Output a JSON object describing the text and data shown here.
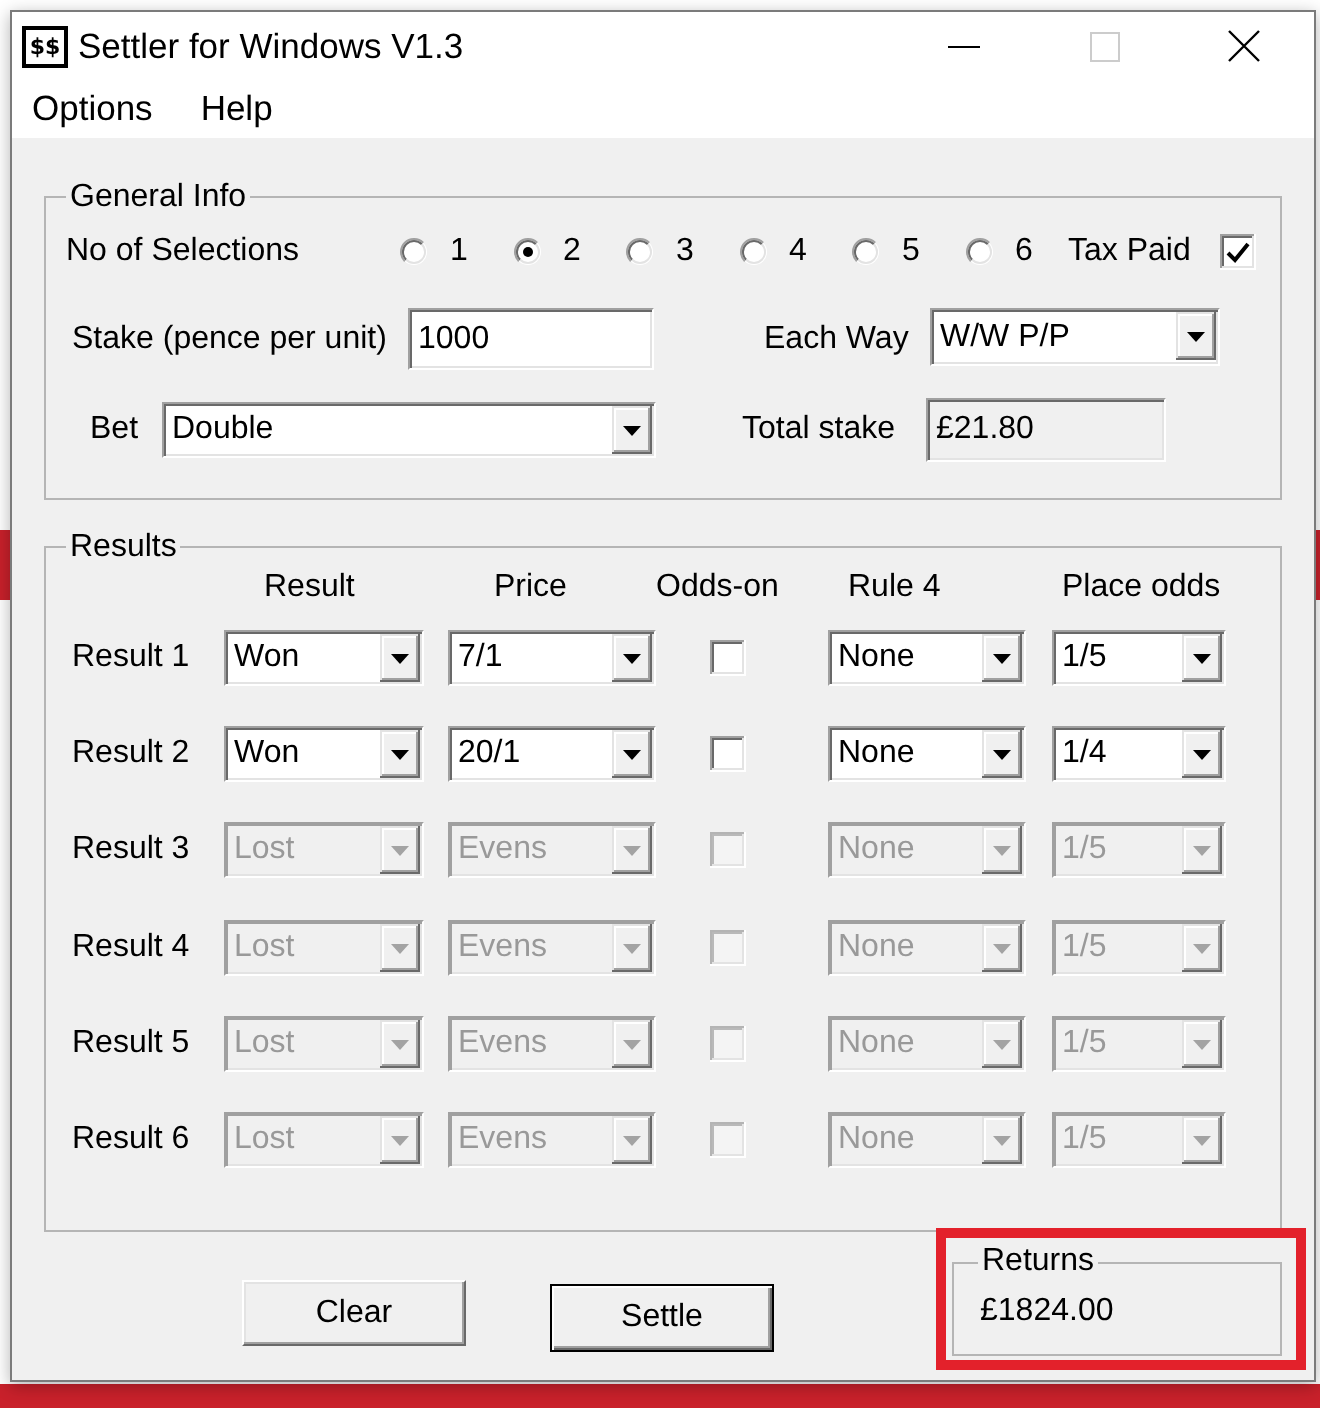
{
  "window": {
    "title": "Settler for Windows V1.3",
    "icon_text": "$$",
    "controls": [
      {
        "kind": "minimize",
        "disabled": false
      },
      {
        "kind": "maximize",
        "disabled": true
      },
      {
        "kind": "close",
        "disabled": false
      }
    ]
  },
  "menu": [
    "Options",
    "Help"
  ],
  "general_info": {
    "legend": "General Info",
    "selections_label": "No of Selections",
    "selections": [
      {
        "label": "1",
        "selected": false
      },
      {
        "label": "2",
        "selected": true
      },
      {
        "label": "3",
        "selected": false
      },
      {
        "label": "4",
        "selected": false
      },
      {
        "label": "5",
        "selected": false
      },
      {
        "label": "6",
        "selected": false
      }
    ],
    "tax_paid": {
      "label": "Tax Paid",
      "checked": true
    },
    "stake": {
      "label": "Stake (pence per unit)",
      "value": "1000"
    },
    "each_way": {
      "label": "Each Way",
      "value": "W/W P/P"
    },
    "bet": {
      "label": "Bet",
      "value": "Double"
    },
    "total_stake": {
      "label": "Total stake",
      "value": "£21.80",
      "read_only": true
    }
  },
  "results": {
    "legend": "Results",
    "columns": [
      "Result",
      "Price",
      "Odds-on",
      "Rule 4",
      "Place odds"
    ],
    "rows": [
      {
        "label": "Result 1",
        "disabled": false,
        "result": "Won",
        "price": "7/1",
        "odds_on": false,
        "rule_4": "None",
        "place_odds": "1/5"
      },
      {
        "label": "Result 2",
        "disabled": false,
        "result": "Won",
        "price": "20/1",
        "odds_on": false,
        "rule_4": "None",
        "place_odds": "1/4"
      },
      {
        "label": "Result 3",
        "disabled": true,
        "result": "Lost",
        "price": "Evens",
        "odds_on": false,
        "rule_4": "None",
        "place_odds": "1/5"
      },
      {
        "label": "Result 4",
        "disabled": true,
        "result": "Lost",
        "price": "Evens",
        "odds_on": false,
        "rule_4": "None",
        "place_odds": "1/5"
      },
      {
        "label": "Result 5",
        "disabled": true,
        "result": "Lost",
        "price": "Evens",
        "odds_on": false,
        "rule_4": "None",
        "place_odds": "1/5"
      },
      {
        "label": "Result 6",
        "disabled": true,
        "result": "Lost",
        "price": "Evens",
        "odds_on": false,
        "rule_4": "None",
        "place_odds": "1/5"
      }
    ]
  },
  "buttons": [
    {
      "label": "Clear",
      "default": false
    },
    {
      "label": "Settle",
      "default": true
    }
  ],
  "returns": {
    "legend": "Returns",
    "value": "£1824.00",
    "highlighted": true
  }
}
